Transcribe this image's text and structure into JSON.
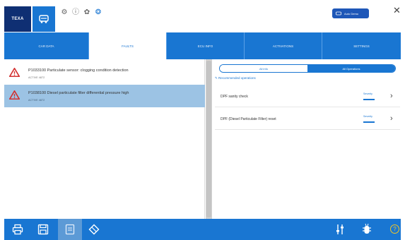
{
  "header": {
    "logo_text": "TEXA",
    "badge_text": "Auto Demo",
    "icons": [
      "car-icon",
      "tool-icon",
      "info-icon",
      "gear-icon",
      "settings-icon"
    ]
  },
  "tabs": [
    {
      "label": "Car Data",
      "active": false
    },
    {
      "label": "Faults",
      "active": true
    },
    {
      "label": "ECU Info",
      "active": false
    },
    {
      "label": "Activations",
      "active": false
    },
    {
      "label": "Settings",
      "active": false
    }
  ],
  "faults": [
    {
      "code_text": "P1033100 Particulate sensor: clogging condition detection",
      "status": "Active 4872",
      "selected": false
    },
    {
      "code_text": "P1038100 Diesel particulate filter differential pressure high",
      "status": "Active 4872",
      "selected": true
    }
  ],
  "panel": {
    "seg_left": "All info",
    "seg_right": "All Operations",
    "recommended_label": "Recommended operations",
    "operations": [
      {
        "label": "DPF sanity check",
        "severity": "Severity"
      },
      {
        "label": "DPF (Diesel Particulate Filter) reset",
        "severity": "Severity"
      }
    ]
  },
  "toolbar": {
    "icons": [
      "print-icon",
      "save-icon",
      "report-icon",
      "eraser-icon",
      "sliders-icon",
      "bug-icon",
      "help-icon"
    ],
    "help_label": "?"
  },
  "colors": {
    "accent": "#1976d2",
    "selected_row": "#9cc3e4",
    "warning": "#d32f2f",
    "help": "#f3c623"
  }
}
